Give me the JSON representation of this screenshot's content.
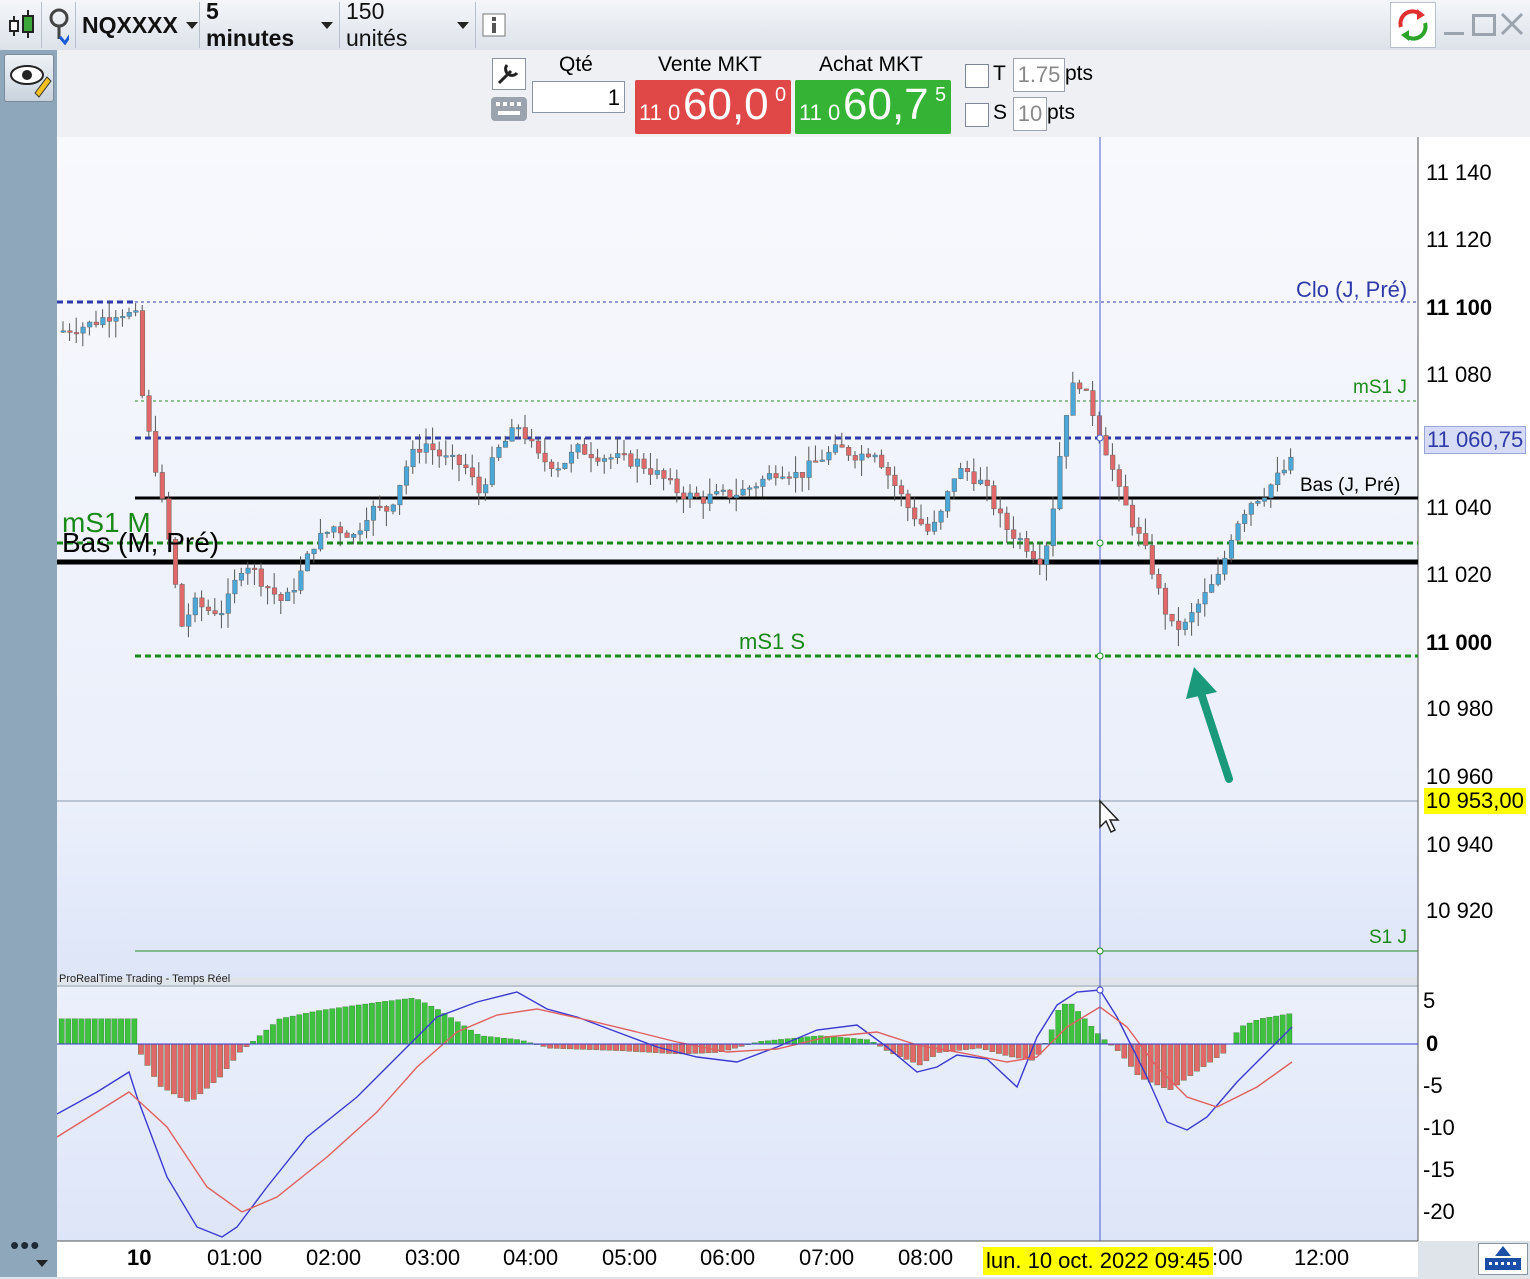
{
  "toolbar": {
    "symbol": "NQXXXX",
    "timeframe": "5 minutes",
    "units": "150 unités",
    "info_icon": "info-icon",
    "refresh_icon": "refresh-icon"
  },
  "order": {
    "qty_label": "Qté",
    "qty_value": "1",
    "sell_label": "Vente MKT",
    "sell_prefix": "11 0",
    "sell_main": "60,0",
    "sell_sup": "0",
    "buy_label": "Achat MKT",
    "buy_prefix": "11 0",
    "buy_main": "60,7",
    "buy_sup": "5",
    "t_label": "T",
    "t_value": "1.75",
    "t_unit": "pts",
    "s_label": "S",
    "s_value": "10",
    "s_unit": "pts",
    "sell_color": "#e04848",
    "buy_color": "#34b334"
  },
  "price_axis": {
    "ticks": [
      "11 140",
      "11 120",
      "11 100",
      "11 080",
      "11 060",
      "11 040",
      "11 020",
      "11 000",
      "10 980",
      "10 960",
      "10 940",
      "10 920"
    ],
    "bold_ticks": [
      "11 100",
      "11 000"
    ],
    "current_price": "11 060,75",
    "cursor_price": "10 953,00"
  },
  "levels": {
    "clo_label": "Clo (J, Pré)",
    "ms1j_label": "mS1 J",
    "bas_j_label": "Bas (J, Pré)",
    "ms1m_label": "mS1 M",
    "bas_m_label": "Bas (M, Pré)",
    "ms1s_label": "mS1 S",
    "s1j_label": "S1 J"
  },
  "indicator": {
    "source_label": "ProRealTime Trading - Temps Réel",
    "ticks": [
      "5",
      "0",
      "-5",
      "-10",
      "-15",
      "-20"
    ]
  },
  "time_axis": {
    "labels": [
      "10",
      "01:00",
      "02:00",
      "03:00",
      "04:00",
      "05:00",
      "06:00",
      "07:00",
      "08:00",
      ":00",
      "12:00"
    ],
    "cursor_date": "lun. 10 oct. 2022 09:45"
  },
  "chart_data": {
    "type": "candlestick",
    "instrument": "NQXXXX",
    "interval": "5 minutes",
    "ylim": [
      10950,
      11150
    ],
    "levels": [
      {
        "name": "Clo (J, Pré)",
        "value": 11102
      },
      {
        "name": "mS1 J",
        "value": 11072
      },
      {
        "name": "Bas (J, Pré)",
        "value": 11043
      },
      {
        "name": "mS1 M",
        "value": 11030
      },
      {
        "name": "Bas (M, Pré)",
        "value": 11024
      },
      {
        "name": "mS1 S",
        "value": 10996
      },
      {
        "name": "S1 J",
        "value": 10908
      }
    ],
    "current_price": 11060.75,
    "cursor_price": 10953.0,
    "macd_ylim": [
      -23,
      7
    ]
  }
}
